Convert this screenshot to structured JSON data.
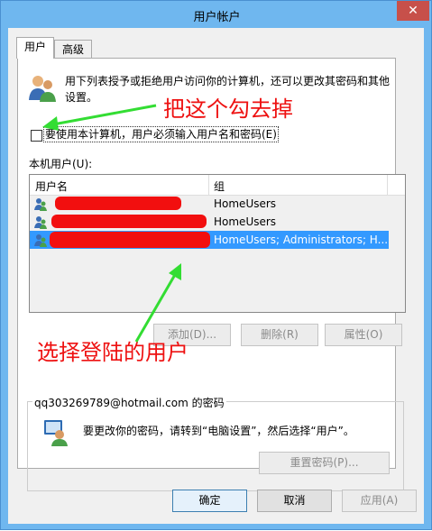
{
  "window": {
    "title": "用户帐户",
    "close_icon": "close-icon"
  },
  "tabs": [
    {
      "label": "用户",
      "active": true
    },
    {
      "label": "高级",
      "active": false
    }
  ],
  "info_text": "用下列表授予或拒绝用户访问你的计算机，还可以更改其密码和其他设置。",
  "checkbox": {
    "label": "要使用本计算机，用户必须输入用户名和密码(E)",
    "checked": false
  },
  "local_users_label": "本机用户(U):",
  "table": {
    "headers": [
      "用户名",
      "组"
    ],
    "rows": [
      {
        "group": "HomeUsers",
        "selected": false
      },
      {
        "group": "HomeUsers",
        "selected": false
      },
      {
        "group": "HomeUsers; Administrators; H...",
        "selected": true
      }
    ]
  },
  "list_buttons": {
    "add": "添加(D)...",
    "remove": "删除(R)",
    "properties": "属性(O)"
  },
  "password_group": {
    "title": "qq303269789@hotmail.com 的密码",
    "text": "要更改你的密码，请转到“电脑设置”，然后选择“用户”。",
    "reset_button": "重置密码(P)..."
  },
  "dialog_buttons": {
    "ok": "确定",
    "cancel": "取消",
    "apply": "应用(A)"
  },
  "annotations": {
    "uncheck": "把这个勾去掉",
    "select_user": "选择登陆的用户"
  },
  "colors": {
    "accent": "#3399ff",
    "annotation_red": "#ee1111",
    "arrow_green": "#33dd33",
    "titlebar": "#6fb7ef"
  }
}
